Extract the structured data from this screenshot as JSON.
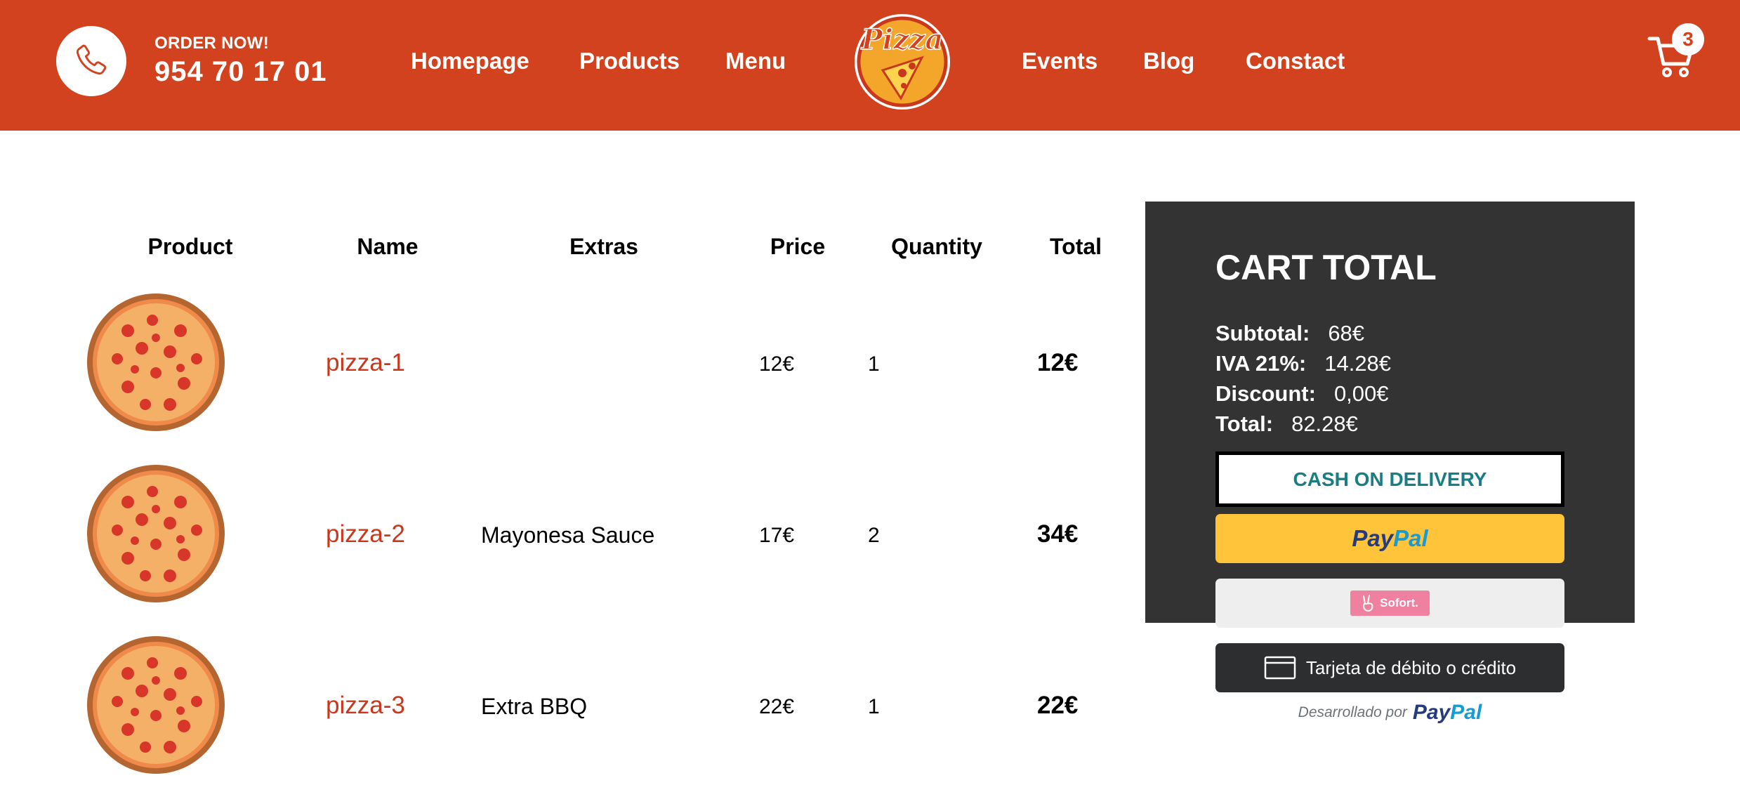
{
  "header": {
    "order_label": "ORDER NOW!",
    "phone": "954 70 17 01",
    "nav": [
      "Homepage",
      "Products",
      "Menu",
      "Events",
      "Blog",
      "Constact"
    ],
    "logo_text": "Pizza",
    "cart_count": "3",
    "colors": {
      "brand": "#d3421e",
      "white": "#ffffff"
    },
    "icons": {
      "phone": "phone-icon",
      "cart": "cart-icon",
      "logo": "pizza-logo"
    }
  },
  "table": {
    "headers": [
      "Product",
      "Name",
      "Extras",
      "Price",
      "Quantity",
      "Total"
    ],
    "rows": [
      {
        "name": "pizza-1",
        "extras": "",
        "price": "12€",
        "quantity": "1",
        "total": "12€"
      },
      {
        "name": "pizza-2",
        "extras": "Mayonesa Sauce",
        "price": "17€",
        "quantity": "2",
        "total": "34€"
      },
      {
        "name": "pizza-3",
        "extras": "Extra BBQ",
        "price": "22€",
        "quantity": "1",
        "total": "22€"
      }
    ]
  },
  "cart_total": {
    "title": "CART TOTAL",
    "subtotal_label": "Subtotal:",
    "subtotal": "68€",
    "iva_label": "IVA 21%:",
    "iva": "14.28€",
    "discount_label": "Discount:",
    "discount": "0,00€",
    "total_label": "Total:",
    "total": "82.28€",
    "cash_button": "CASH ON DELIVERY",
    "paypal_a": "Pay",
    "paypal_b": "Pal",
    "sofort_label": "Sofort.",
    "card_button": "Tarjeta de débito o crédito",
    "powered_by": "Desarrollado por",
    "colors": {
      "panel": "#333333",
      "paypal": "#ffc439",
      "card": "#2c2e2f",
      "cash_text": "#197d84"
    }
  }
}
